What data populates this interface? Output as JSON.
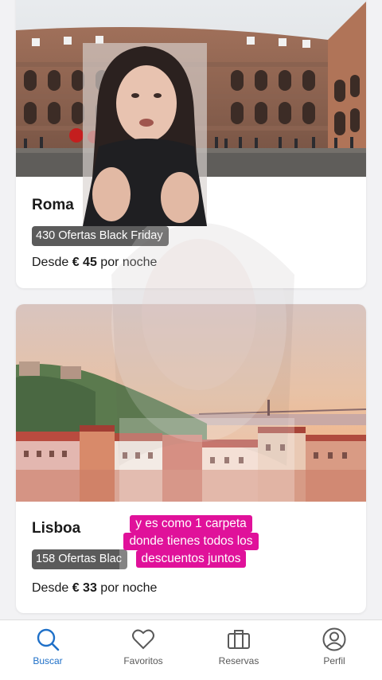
{
  "cards": [
    {
      "city": "Roma",
      "badge": "430 Ofertas Black Friday",
      "price_prefix": "Desde ",
      "price_value": "€ 45",
      "price_suffix": " por noche"
    },
    {
      "city": "Lisboa",
      "badge": "158 Ofertas Blac",
      "price_prefix": "Desde ",
      "price_value": "€ 33",
      "price_suffix": " por noche"
    }
  ],
  "caption": {
    "line1": "y es como 1 carpeta",
    "line2": "donde tienes todos los",
    "line3": "descuentos juntos"
  },
  "tabs": [
    {
      "label": "Buscar",
      "icon": "search-icon",
      "active": true
    },
    {
      "label": "Favoritos",
      "icon": "heart-icon",
      "active": false
    },
    {
      "label": "Reservas",
      "icon": "briefcase-icon",
      "active": false
    },
    {
      "label": "Perfil",
      "icon": "user-circle-icon",
      "active": false
    }
  ],
  "colors": {
    "accent": "#1f70c8",
    "caption_bg": "#e0119a",
    "badge_bg": "#5b5b5b"
  }
}
